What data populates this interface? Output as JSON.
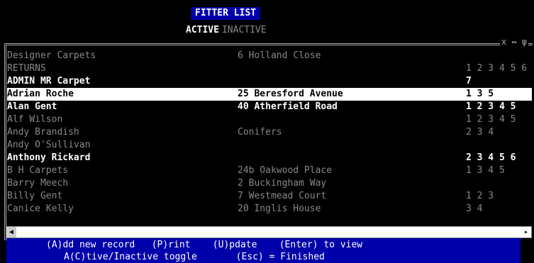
{
  "title": "FITTER LIST",
  "tabs": {
    "active": "ACTIVE",
    "inactive": "INACTIVE"
  },
  "window_icons": "x ↔ ψ",
  "rows": [
    {
      "name": "Designer Carpets",
      "address": "6 Holland Close",
      "codes": "",
      "style": "dim"
    },
    {
      "name": "RETURNS",
      "address": "",
      "codes": "1 2 3 4 5 6",
      "style": "dim"
    },
    {
      "name": "ADMIN MR Carpet",
      "address": "",
      "codes": "7",
      "style": "bright"
    },
    {
      "name": "Adrian Roche",
      "address": "25 Beresford Avenue",
      "codes": "1 3 5",
      "style": "selected"
    },
    {
      "name": "Alan Gent",
      "address": "40 Atherfield Road",
      "codes": "1 2 3 4 5",
      "style": "bright"
    },
    {
      "name": "Alf Wilson",
      "address": "",
      "codes": "1 2 3 4 5",
      "style": "dim"
    },
    {
      "name": "Andy Brandish",
      "address": "Conifers",
      "codes": "2 3 4",
      "style": "dim"
    },
    {
      "name": "Andy O'Sullivan",
      "address": "",
      "codes": "",
      "style": "dim"
    },
    {
      "name": "Anthony Rickard",
      "address": "",
      "codes": "2 3 4 5 6",
      "style": "bright"
    },
    {
      "name": "B H Carpets",
      "address": "24b Oakwood Place",
      "codes": "1 3 4 5",
      "style": "dim"
    },
    {
      "name": "Barry Meech",
      "address": "2 Buckingham Way",
      "codes": "",
      "style": "dim"
    },
    {
      "name": "Billy Gent",
      "address": "7 Westmead Court",
      "codes": "1 2 3",
      "style": "dim"
    },
    {
      "name": "Canice Kelly",
      "address": "20 Inglis House",
      "codes": "3 4",
      "style": "dim"
    }
  ],
  "footer": {
    "line1": "(A)dd new record   (P)rint    (U)pdate    (Enter) to view",
    "line2": "A(C)tive/Inactive toggle       (Esc) = Finished"
  }
}
